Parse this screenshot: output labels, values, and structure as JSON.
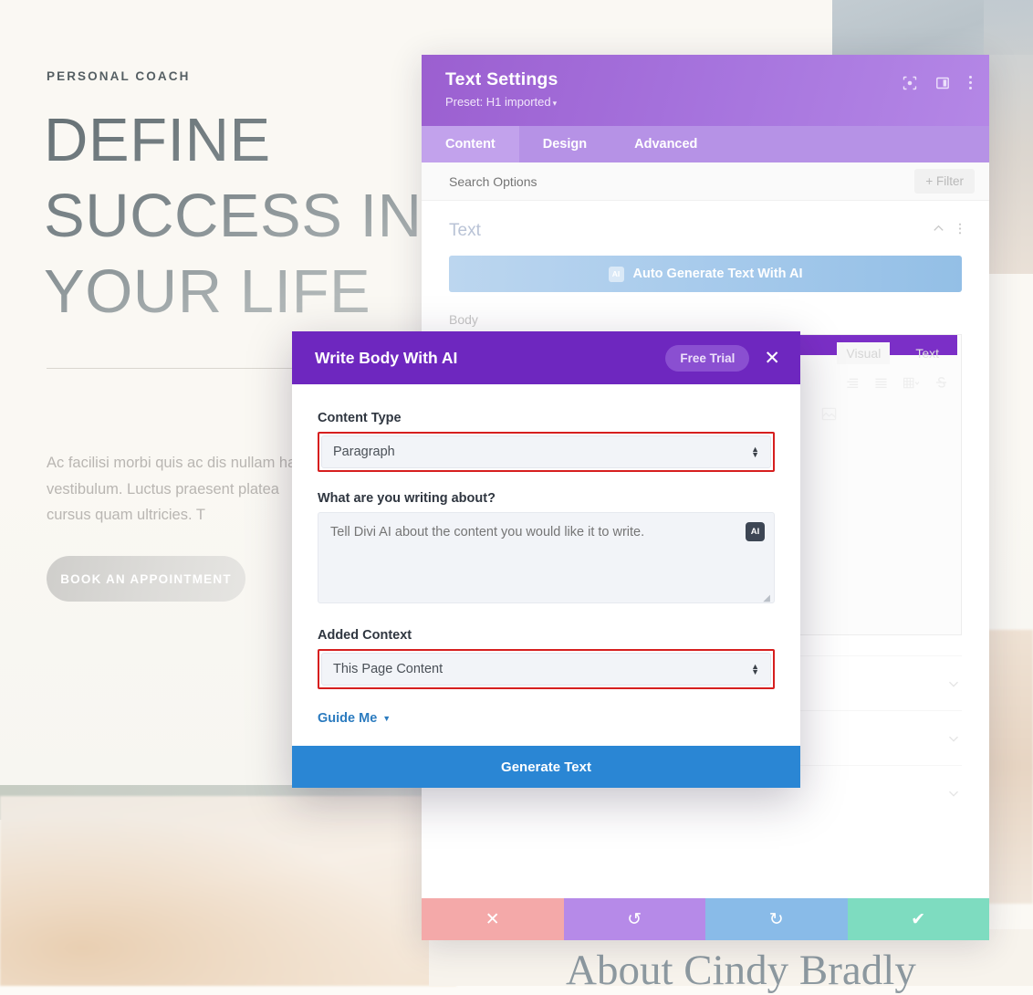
{
  "website": {
    "eyebrow": "PERSONAL COACH",
    "heading": "DEFINE SUCCESS IN YOUR LIFE",
    "body": "Ac facilisi morbi quis ac dis nullam hac vestibulum. Luctus praesent platea cursus quam ultricies. T",
    "cta_label": "BOOK AN APPOINTMENT",
    "faded_word": "Life",
    "about_title": "About Cindy Bradly"
  },
  "settings_panel": {
    "title": "Text Settings",
    "preset": "Preset: H1 imported",
    "preset_caret": "▾",
    "header_icons": [
      "focus-icon",
      "layout-panel-icon",
      "more-options-icon"
    ],
    "tabs": [
      {
        "label": "Content",
        "active": true
      },
      {
        "label": "Design",
        "active": false
      },
      {
        "label": "Advanced",
        "active": false
      }
    ],
    "search_placeholder": "Search Options",
    "filter_label": "Filter",
    "filter_plus": "+",
    "section": {
      "title": "Text",
      "ai_button_label": "Auto Generate Text With AI",
      "ai_chip_label": "AI",
      "body_label": "Body"
    },
    "editor": {
      "tabs": [
        {
          "label": "Visual",
          "active": true
        },
        {
          "label": "Text",
          "active": false
        }
      ]
    },
    "footer_buttons": [
      {
        "name": "discard-button",
        "glyph": "✕",
        "color": "#f4a9a9"
      },
      {
        "name": "undo-button",
        "glyph": "↺",
        "color": "#b68ae8"
      },
      {
        "name": "redo-button",
        "glyph": "↻",
        "color": "#89bbe8"
      },
      {
        "name": "save-button",
        "glyph": "✔",
        "color": "#7edcc0"
      }
    ]
  },
  "ai_modal": {
    "title": "Write Body With AI",
    "free_trial_label": "Free Trial",
    "close_glyph": "✕",
    "content_type": {
      "label": "Content Type",
      "value": "Paragraph",
      "highlight_color": "#d61f1f"
    },
    "prompt": {
      "label": "What are you writing about?",
      "placeholder": "Tell Divi AI about the content you would like it to write.",
      "value": "",
      "badge_label": "AI"
    },
    "added_context": {
      "label": "Added Context",
      "value": "This Page Content",
      "highlight_color": "#d61f1f"
    },
    "guide_me": {
      "label": "Guide Me",
      "caret": "▼"
    },
    "generate_label": "Generate Text"
  }
}
